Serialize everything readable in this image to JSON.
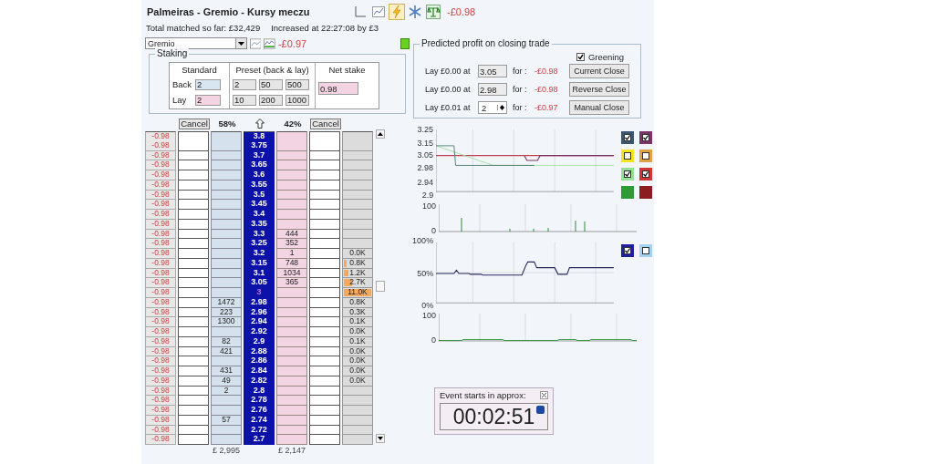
{
  "header": {
    "title": "Palmeiras - Gremio - Kursy meczu",
    "profit": "-£0.98",
    "matched": "Total matched so far: £32,429",
    "increased": "Increased at 22:27:08 by £3",
    "selection": "Gremio",
    "selection_profit": "-£0.97"
  },
  "staking": {
    "title": "Staking",
    "standard_label": "Standard",
    "back_label": "Back",
    "back": "2",
    "lay_label": "Lay",
    "lay": "2",
    "preset_label": "Preset (back & lay)",
    "presets": [
      "2",
      "50",
      "500",
      "10",
      "200",
      "1000"
    ],
    "net_label": "Net stake",
    "net": "0.98"
  },
  "closing": {
    "title": "Predicted profit on closing trade",
    "greening": {
      "label": "Greening",
      "checked": true
    },
    "rows": [
      {
        "kind": "fixed",
        "prefix": "Lay £0.00 at",
        "odds": "3.05",
        "for": "for :",
        "profit": "-£0.98",
        "button": "Current Close"
      },
      {
        "kind": "fixed",
        "prefix": "Lay £0.00 at",
        "odds": "2.98",
        "for": "for :",
        "profit": "-£0.98",
        "button": "Reverse Close"
      },
      {
        "kind": "spinner",
        "prefix": "Lay £0.01 at",
        "odds": "2",
        "for": "for :",
        "profit": "-£0.97",
        "button": "Manual Close"
      }
    ]
  },
  "ladder": {
    "cancel_back": "Cancel",
    "back_percent": "58%",
    "lay_percent": "42%",
    "cancel_lay": "Cancel",
    "back_total": "£ 2,995",
    "lay_total": "£ 2,147",
    "rows": [
      {
        "pl": "-0.98",
        "price": "3.8",
        "last_traded": false
      },
      {
        "pl": "-0.98",
        "price": "3.75",
        "last_traded": false
      },
      {
        "pl": "-0.98",
        "price": "3.7",
        "last_traded": false
      },
      {
        "pl": "-0.98",
        "price": "3.65",
        "last_traded": false
      },
      {
        "pl": "-0.98",
        "price": "3.6",
        "last_traded": false
      },
      {
        "pl": "-0.98",
        "price": "3.55",
        "last_traded": false
      },
      {
        "pl": "-0.98",
        "price": "3.5",
        "last_traded": false
      },
      {
        "pl": "-0.98",
        "price": "3.45",
        "last_traded": false
      },
      {
        "pl": "-0.98",
        "price": "3.4",
        "last_traded": false
      },
      {
        "pl": "-0.98",
        "price": "3.35",
        "last_traded": false
      },
      {
        "pl": "-0.98",
        "price": "3.3",
        "lay": "444",
        "last_traded": false
      },
      {
        "pl": "-0.98",
        "price": "3.25",
        "lay": "352",
        "last_traded": false
      },
      {
        "pl": "-0.98",
        "price": "3.2",
        "lay": "1",
        "volume": {
          "text": "0.0K"
        },
        "last_traded": false
      },
      {
        "pl": "-0.98",
        "price": "3.15",
        "lay": "748",
        "volume": {
          "text": "0.8K",
          "level": 0.1
        },
        "last_traded": false
      },
      {
        "pl": "-0.98",
        "price": "3.1",
        "lay": "1034",
        "volume": {
          "text": "1.2K",
          "level": 0.15
        },
        "last_traded": false
      },
      {
        "pl": "-0.98",
        "price": "3.05",
        "lay": "365",
        "volume": {
          "text": "2.7K",
          "level": 0.3
        },
        "last_traded": false
      },
      {
        "pl": "-0.98",
        "price": "3",
        "volume": {
          "text": "11.0K",
          "level": 1
        },
        "last_traded": true
      },
      {
        "pl": "-0.98",
        "price": "2.98",
        "back": "1472",
        "volume": {
          "text": "0.8K"
        },
        "last_traded": false
      },
      {
        "pl": "-0.98",
        "price": "2.96",
        "back": "223",
        "volume": {
          "text": "0.3K"
        },
        "last_traded": false
      },
      {
        "pl": "-0.98",
        "price": "2.94",
        "back": "1300",
        "volume": {
          "text": "0.1K"
        },
        "last_traded": false
      },
      {
        "pl": "-0.98",
        "price": "2.92",
        "volume": {
          "text": "0.0K"
        },
        "last_traded": false
      },
      {
        "pl": "-0.98",
        "price": "2.9",
        "back": "82",
        "volume": {
          "text": "0.1K"
        },
        "last_traded": false
      },
      {
        "pl": "-0.98",
        "price": "2.88",
        "back": "421",
        "volume": {
          "text": "0.0K"
        },
        "last_traded": false
      },
      {
        "pl": "-0.98",
        "price": "2.86",
        "volume": {
          "text": "0.0K"
        },
        "last_traded": false
      },
      {
        "pl": "-0.98",
        "price": "2.84",
        "back": "431",
        "volume": {
          "text": "0.0K"
        },
        "last_traded": false
      },
      {
        "pl": "-0.98",
        "price": "2.82",
        "back": "49",
        "volume": {
          "text": "0.0K"
        },
        "last_traded": false
      },
      {
        "pl": "-0.98",
        "price": "2.8",
        "back": "2",
        "last_traded": false
      },
      {
        "pl": "-0.98",
        "price": "2.78",
        "last_traded": false
      },
      {
        "pl": "-0.98",
        "price": "2.76",
        "last_traded": false
      },
      {
        "pl": "-0.98",
        "price": "2.74",
        "back": "57",
        "last_traded": false
      },
      {
        "pl": "-0.98",
        "price": "2.72",
        "last_traded": false
      },
      {
        "pl": "-0.98",
        "price": "2.7",
        "last_traded": false
      }
    ]
  },
  "charts": {
    "price": {
      "ticks": [
        "3.25",
        "3.15",
        "3.05",
        "2.98",
        "2.94",
        "2.9"
      ],
      "legend": [
        {
          "kind": "checkbox",
          "color": "#3c5670",
          "checked": true
        },
        {
          "kind": "checkbox",
          "color": "#7c3466",
          "checked": true
        },
        {
          "kind": "checkbox",
          "color": "#f2e41e",
          "checked": false
        },
        {
          "kind": "checkbox",
          "color": "#e4a046",
          "checked": false
        },
        {
          "kind": "checkbox",
          "color": "#94e094",
          "checked": true
        },
        {
          "kind": "checkbox",
          "color": "#d03434",
          "checked": true
        },
        {
          "kind": "swatch",
          "color": "#2e9a36"
        },
        {
          "kind": "swatch",
          "color": "#8c1e22"
        }
      ]
    },
    "volume": {
      "ticks": [
        "100",
        "0"
      ]
    },
    "percent": {
      "ticks": [
        "100%",
        "50%",
        "0%"
      ],
      "legend": [
        {
          "kind": "checkbox",
          "color": "#1e20a0",
          "checked": true
        },
        {
          "kind": "checkbox",
          "color": "#a4d2f0",
          "checked": false
        }
      ]
    },
    "activity": {
      "ticks": [
        "100",
        "0"
      ]
    }
  },
  "countdown": {
    "title": "Event starts in approx:",
    "time": "00:02:51"
  }
}
